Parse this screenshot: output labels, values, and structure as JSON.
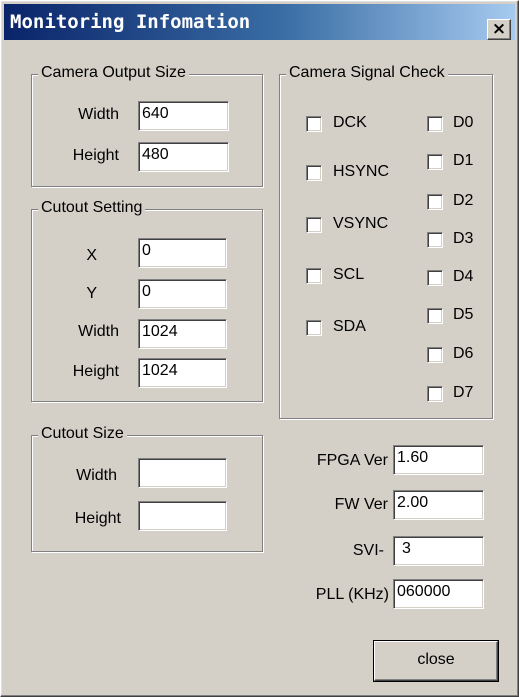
{
  "window": {
    "title": "Monitoring Infomation",
    "close_glyph": "×"
  },
  "camera_output": {
    "legend": "Camera Output Size",
    "width_label": "Width",
    "width_value": "640",
    "height_label": "Height",
    "height_value": "480"
  },
  "cutout_setting": {
    "legend": "Cutout Setting",
    "x_label": "X",
    "x_value": "0",
    "y_label": "Y",
    "y_value": "0",
    "width_label": "Width",
    "width_value": "1024",
    "height_label": "Height",
    "height_value": "1024"
  },
  "cutout_size": {
    "legend": "Cutout Size",
    "width_label": "Width",
    "width_value": "",
    "height_label": "Height",
    "height_value": ""
  },
  "signal_check": {
    "legend": "Camera Signal Check",
    "left": [
      {
        "label": "DCK",
        "checked": false
      },
      {
        "label": "HSYNC",
        "checked": false
      },
      {
        "label": "VSYNC",
        "checked": false
      },
      {
        "label": "SCL",
        "checked": false
      },
      {
        "label": "SDA",
        "checked": false
      }
    ],
    "right": [
      {
        "label": "D0",
        "checked": false
      },
      {
        "label": "D1",
        "checked": false
      },
      {
        "label": "D2",
        "checked": false
      },
      {
        "label": "D3",
        "checked": false
      },
      {
        "label": "D4",
        "checked": false
      },
      {
        "label": "D5",
        "checked": false
      },
      {
        "label": "D6",
        "checked": false
      },
      {
        "label": "D7",
        "checked": false
      }
    ]
  },
  "info": {
    "fpga_label": "FPGA Ver",
    "fpga_value": "1.60",
    "fw_label": "FW Ver",
    "fw_value": "2.00",
    "svi_label": "SVI-",
    "svi_value": "3",
    "pll_label": "PLL (KHz)",
    "pll_value": "060000"
  },
  "close_button_label": "close"
}
